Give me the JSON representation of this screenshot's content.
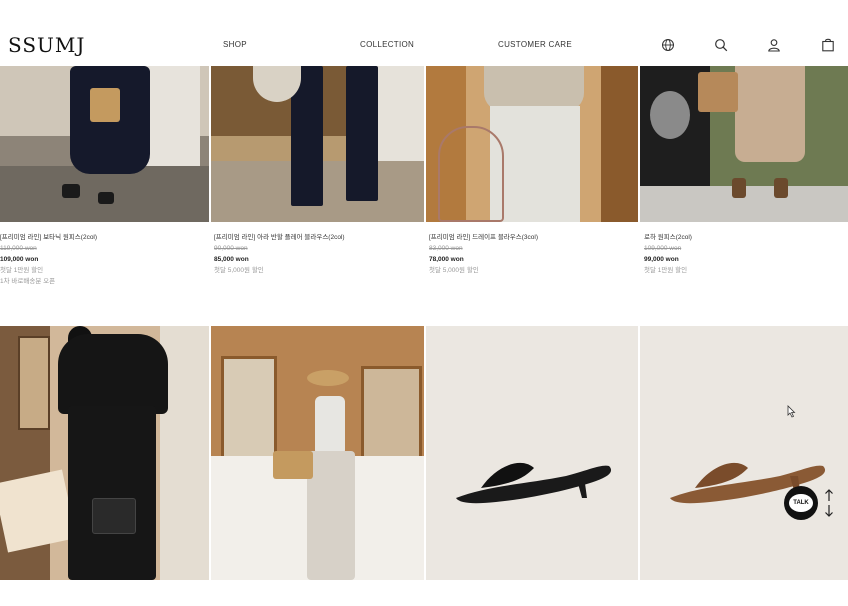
{
  "brand": {
    "logo": "SSUMJ"
  },
  "nav": {
    "items": [
      {
        "label": "SHOP"
      },
      {
        "label": "COLLECTION"
      },
      {
        "label": "CUSTOMER CARE"
      }
    ]
  },
  "header_icons": [
    "globe-icon",
    "search-icon",
    "user-icon",
    "bag-icon"
  ],
  "products": [
    {
      "name": "[프리미엄 라인] 보타닉 원피스(2col)",
      "original_price": "119,000 won",
      "price": "109,000 won",
      "promo": [
        "첫달 1만원 할인",
        "1차 바로배송분 오픈"
      ]
    },
    {
      "name": "[프리미엄 라인] 아라 반할 플레어 블라우스(2col)",
      "original_price": "90,000 won",
      "price": "85,000 won",
      "promo": [
        "첫달 5,000원 할인"
      ]
    },
    {
      "name": "[프리미엄 라인] 드레이프 블라우스(3col)",
      "original_price": "83,000 won",
      "price": "78,000 won",
      "promo": [
        "첫달 5,000원 할인"
      ]
    },
    {
      "name": "로하 원피스(2col)",
      "original_price": "109,000 won",
      "price": "99,000 won",
      "promo": [
        "첫달 1만원 할인"
      ]
    }
  ],
  "talk_button": {
    "label": "TALK"
  },
  "colors": {
    "background": "#ffffff",
    "text": "#222222",
    "muted": "#999999",
    "talk_bg": "#111111"
  }
}
